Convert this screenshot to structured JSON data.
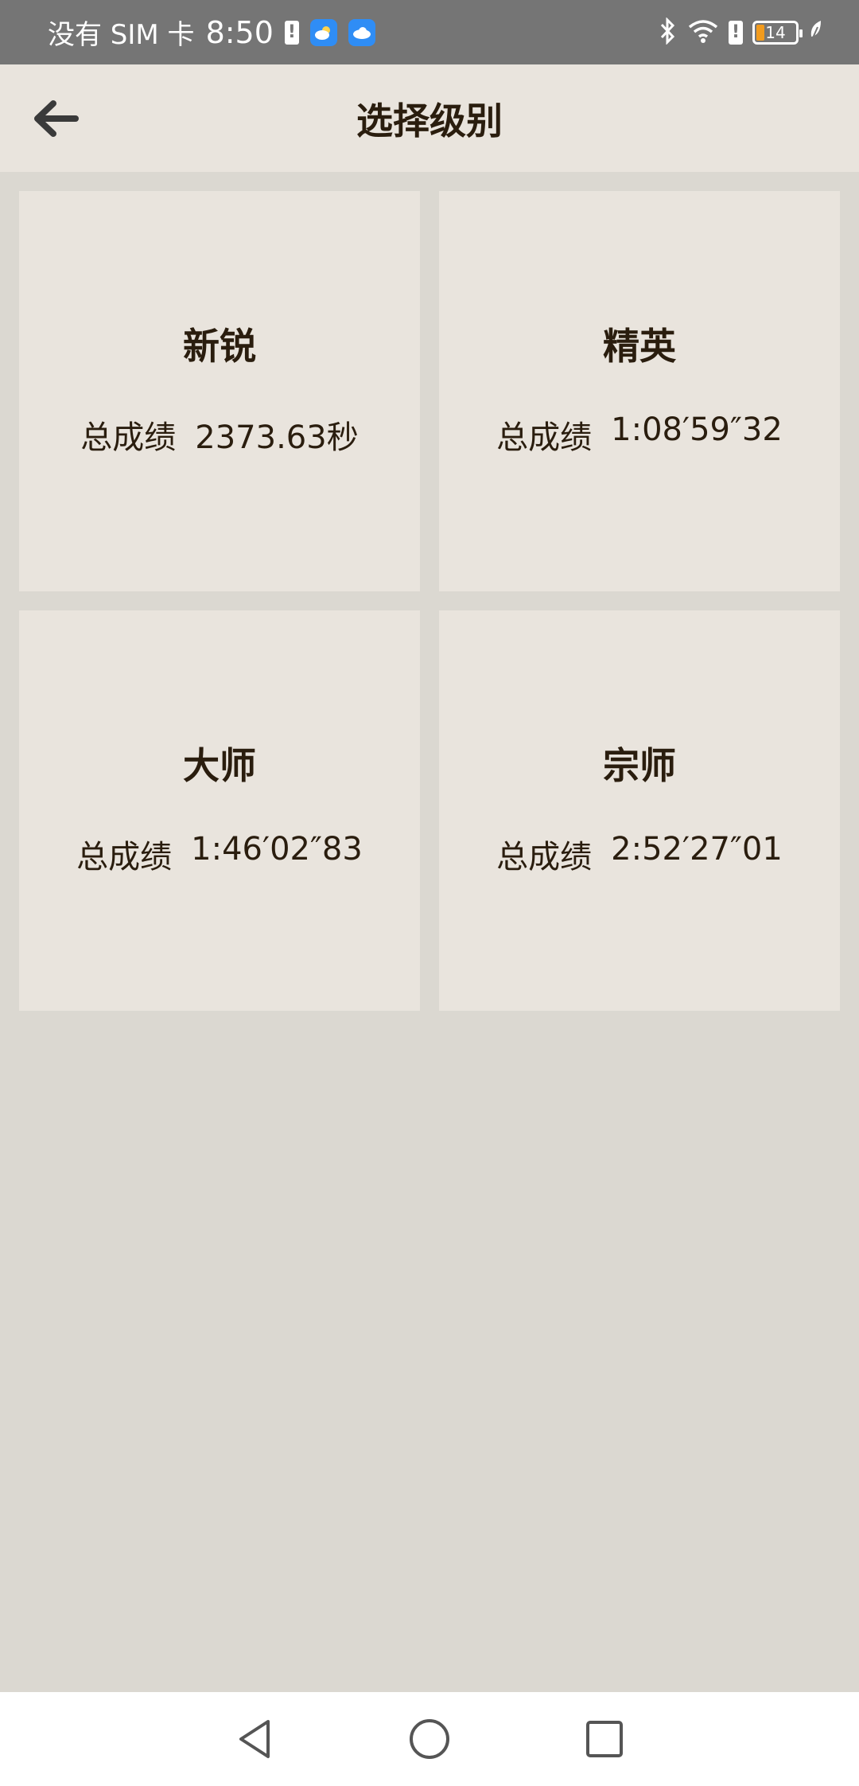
{
  "status_bar": {
    "carrier": "没有 SIM 卡",
    "time": "8:50",
    "battery_level": "14",
    "icons": [
      "alert-icon",
      "weather-app-icon",
      "cloud-app-icon",
      "bluetooth-icon",
      "wifi-icon",
      "alert-icon",
      "battery-icon",
      "leaf-icon"
    ]
  },
  "app_bar": {
    "title": "选择级别",
    "back_icon": "arrow-left-icon"
  },
  "levels": [
    {
      "name": "新锐",
      "score_label": "总成绩",
      "score_value": "2373.63秒"
    },
    {
      "name": "精英",
      "score_label": "总成绩",
      "score_value": "1:08′59″32"
    },
    {
      "name": "大师",
      "score_label": "总成绩",
      "score_value": "1:46′02″83"
    },
    {
      "name": "宗师",
      "score_label": "总成绩",
      "score_value": "2:52′27″01"
    }
  ],
  "nav_bar": {
    "icons": [
      "back-triangle-icon",
      "home-circle-icon",
      "recents-square-icon"
    ]
  },
  "colors": {
    "status_bar_bg": "#757575",
    "app_bar_bg": "#e9e4dd",
    "page_bg": "#dbd8d1",
    "card_bg": "#e9e4dd",
    "text": "#2a1d0e",
    "battery_accent": "#f29b1d"
  }
}
